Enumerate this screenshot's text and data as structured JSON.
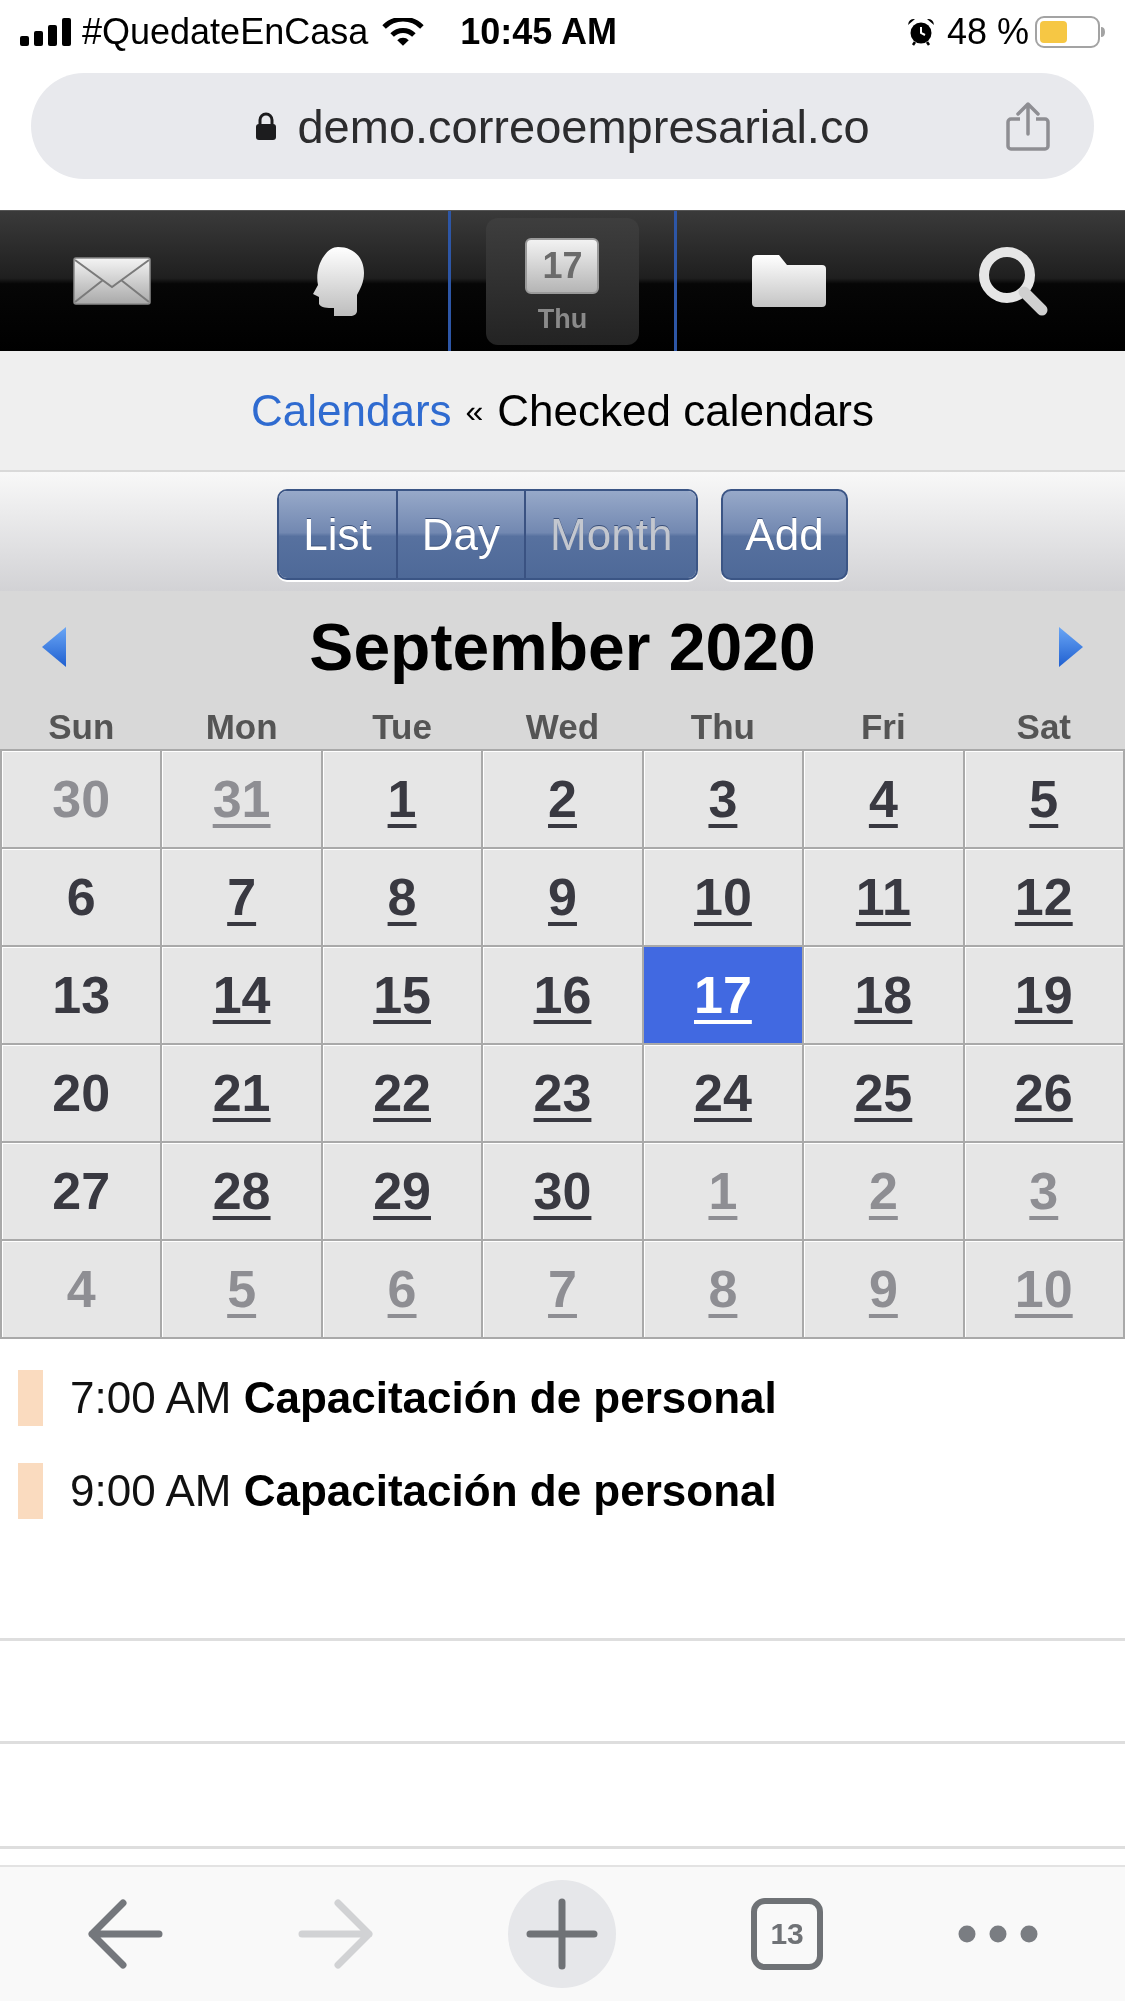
{
  "status_bar": {
    "carrier": "#QuedateEnCasa",
    "time": "10:45 AM",
    "battery": "48 %"
  },
  "address_bar": {
    "url": "demo.correoempresarial.co"
  },
  "nav": [
    {
      "kind": "mail",
      "selected": false
    },
    {
      "kind": "contacts",
      "selected": false
    },
    {
      "kind": "calendar",
      "selected": true,
      "date": "17",
      "day": "Thu"
    },
    {
      "kind": "files",
      "selected": false
    },
    {
      "kind": "search",
      "selected": false
    }
  ],
  "breadcrumb": {
    "link": "Calendars",
    "separator": "«",
    "current": "Checked calendars"
  },
  "view_buttons": [
    {
      "label": "List",
      "selected": false
    },
    {
      "label": "Day",
      "selected": false
    },
    {
      "label": "Month",
      "selected": true
    }
  ],
  "add_button": "Add",
  "calendar": {
    "title": "September 2020",
    "weekdays": [
      "Sun",
      "Mon",
      "Tue",
      "Wed",
      "Thu",
      "Fri",
      "Sat"
    ],
    "weeks": [
      [
        {
          "label": "30",
          "other_month": true,
          "link": false,
          "selected": false
        },
        {
          "label": "31",
          "other_month": true,
          "link": true,
          "selected": false
        },
        {
          "label": "1",
          "other_month": false,
          "link": true,
          "selected": false
        },
        {
          "label": "2",
          "other_month": false,
          "link": true,
          "selected": false
        },
        {
          "label": "3",
          "other_month": false,
          "link": true,
          "selected": false
        },
        {
          "label": "4",
          "other_month": false,
          "link": true,
          "selected": false
        },
        {
          "label": "5",
          "other_month": false,
          "link": true,
          "selected": false
        }
      ],
      [
        {
          "label": "6",
          "other_month": false,
          "link": false,
          "selected": false
        },
        {
          "label": "7",
          "other_month": false,
          "link": true,
          "selected": false
        },
        {
          "label": "8",
          "other_month": false,
          "link": true,
          "selected": false
        },
        {
          "label": "9",
          "other_month": false,
          "link": true,
          "selected": false
        },
        {
          "label": "10",
          "other_month": false,
          "link": true,
          "selected": false
        },
        {
          "label": "11",
          "other_month": false,
          "link": true,
          "selected": false
        },
        {
          "label": "12",
          "other_month": false,
          "link": true,
          "selected": false
        }
      ],
      [
        {
          "label": "13",
          "other_month": false,
          "link": false,
          "selected": false
        },
        {
          "label": "14",
          "other_month": false,
          "link": true,
          "selected": false
        },
        {
          "label": "15",
          "other_month": false,
          "link": true,
          "selected": false
        },
        {
          "label": "16",
          "other_month": false,
          "link": true,
          "selected": false
        },
        {
          "label": "17",
          "other_month": false,
          "link": true,
          "selected": true
        },
        {
          "label": "18",
          "other_month": false,
          "link": true,
          "selected": false
        },
        {
          "label": "19",
          "other_month": false,
          "link": true,
          "selected": false
        }
      ],
      [
        {
          "label": "20",
          "other_month": false,
          "link": false,
          "selected": false
        },
        {
          "label": "21",
          "other_month": false,
          "link": true,
          "selected": false
        },
        {
          "label": "22",
          "other_month": false,
          "link": true,
          "selected": false
        },
        {
          "label": "23",
          "other_month": false,
          "link": true,
          "selected": false
        },
        {
          "label": "24",
          "other_month": false,
          "link": true,
          "selected": false
        },
        {
          "label": "25",
          "other_month": false,
          "link": true,
          "selected": false
        },
        {
          "label": "26",
          "other_month": false,
          "link": true,
          "selected": false
        }
      ],
      [
        {
          "label": "27",
          "other_month": false,
          "link": false,
          "selected": false
        },
        {
          "label": "28",
          "other_month": false,
          "link": true,
          "selected": false
        },
        {
          "label": "29",
          "other_month": false,
          "link": true,
          "selected": false
        },
        {
          "label": "30",
          "other_month": false,
          "link": true,
          "selected": false
        },
        {
          "label": "1",
          "other_month": true,
          "link": true,
          "selected": false
        },
        {
          "label": "2",
          "other_month": true,
          "link": true,
          "selected": false
        },
        {
          "label": "3",
          "other_month": true,
          "link": true,
          "selected": false
        }
      ],
      [
        {
          "label": "4",
          "other_month": true,
          "link": false,
          "selected": false
        },
        {
          "label": "5",
          "other_month": true,
          "link": true,
          "selected": false
        },
        {
          "label": "6",
          "other_month": true,
          "link": true,
          "selected": false
        },
        {
          "label": "7",
          "other_month": true,
          "link": true,
          "selected": false
        },
        {
          "label": "8",
          "other_month": true,
          "link": true,
          "selected": false
        },
        {
          "label": "9",
          "other_month": true,
          "link": true,
          "selected": false
        },
        {
          "label": "10",
          "other_month": true,
          "link": true,
          "selected": false
        }
      ]
    ]
  },
  "events": [
    {
      "time": "7:00 AM",
      "title": "Capacitación de personal",
      "color": "#fadbbf"
    },
    {
      "time": "9:00 AM",
      "title": "Capacitación de personal",
      "color": "#fadbbf"
    }
  ],
  "browser_toolbar": {
    "back_disabled": false,
    "forward_disabled": true,
    "tab_count": "13"
  }
}
